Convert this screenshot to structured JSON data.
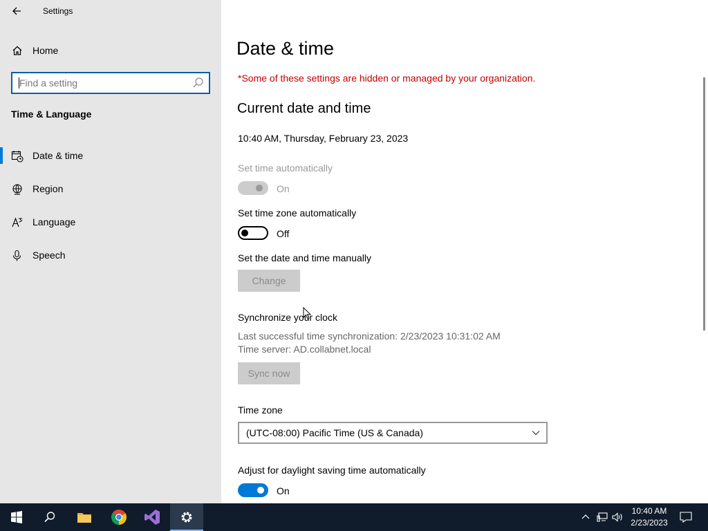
{
  "window": {
    "title": "Settings"
  },
  "sidebar": {
    "home_label": "Home",
    "search_placeholder": "Find a setting",
    "section_title": "Time & Language",
    "items": [
      {
        "label": "Date & time",
        "icon": "calendar-clock-icon",
        "active": true
      },
      {
        "label": "Region",
        "icon": "globe-icon",
        "active": false
      },
      {
        "label": "Language",
        "icon": "language-icon",
        "active": false
      },
      {
        "label": "Speech",
        "icon": "microphone-icon",
        "active": false
      }
    ]
  },
  "content": {
    "page_title": "Date & time",
    "org_note": "*Some of these settings are hidden or managed by your organization.",
    "current_title": "Current date and time",
    "current_datetime": "10:40 AM, Thursday, February 23, 2023",
    "set_time_auto": {
      "label": "Set time automatically",
      "state": "On"
    },
    "set_tz_auto": {
      "label": "Set time zone automatically",
      "state": "Off"
    },
    "manual": {
      "label": "Set the date and time manually",
      "button": "Change"
    },
    "sync": {
      "label": "Synchronize your clock",
      "last_sync": "Last successful time synchronization: 2/23/2023 10:31:02 AM",
      "server": "Time server: AD.collabnet.local",
      "button": "Sync now"
    },
    "timezone": {
      "label": "Time zone",
      "value": "(UTC-08:00) Pacific Time (US & Canada)"
    },
    "dst": {
      "label": "Adjust for daylight saving time automatically",
      "state": "On"
    }
  },
  "taskbar": {
    "time": "10:40 AM",
    "date": "2/23/2023"
  },
  "colors": {
    "accent": "#0078d7",
    "warning_text": "#c50000",
    "taskbar_bg": "#101c2c",
    "sidebar_bg": "#e6e6e6"
  }
}
